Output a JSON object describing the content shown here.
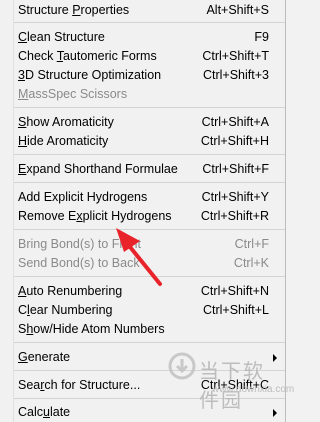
{
  "menu": {
    "items": [
      {
        "label": "Structure Properties",
        "u": 10,
        "shortcut": "Alt+Shift+S",
        "enabled": true
      },
      {
        "label": "Clean Structure",
        "u": 0,
        "shortcut": "F9",
        "enabled": true
      },
      {
        "label": "Check Tautomeric Forms",
        "u": 6,
        "shortcut": "Ctrl+Shift+T",
        "enabled": true
      },
      {
        "label": "3D Structure Optimization",
        "u": 0,
        "shortcut": "Ctrl+Shift+3",
        "enabled": true
      },
      {
        "label": "MassSpec Scissors",
        "u": 0,
        "shortcut": "",
        "enabled": false
      },
      {
        "label": "Show Aromaticity",
        "u": 0,
        "shortcut": "Ctrl+Shift+A",
        "enabled": true
      },
      {
        "label": "Hide Aromaticity",
        "u": 0,
        "shortcut": "Ctrl+Shift+H",
        "enabled": true
      },
      {
        "label": "Expand Shorthand Formulae",
        "u": 0,
        "shortcut": "Ctrl+Shift+F",
        "enabled": true
      },
      {
        "label": "Add Explicit Hydrogens",
        "u": -1,
        "shortcut": "Ctrl+Shift+Y",
        "enabled": true
      },
      {
        "label": "Remove Explicit Hydrogens",
        "u": 8,
        "shortcut": "Ctrl+Shift+R",
        "enabled": true
      },
      {
        "label": "Bring Bond(s) to Front",
        "u": -1,
        "shortcut": "Ctrl+F",
        "enabled": false
      },
      {
        "label": "Send Bond(s) to Back",
        "u": -1,
        "shortcut": "Ctrl+K",
        "enabled": false
      },
      {
        "label": "Auto Renumbering",
        "u": 0,
        "shortcut": "Ctrl+Shift+N",
        "enabled": true
      },
      {
        "label": "Clear Numbering",
        "u": 1,
        "shortcut": "Ctrl+Shift+L",
        "enabled": true
      },
      {
        "label": "Show/Hide Atom Numbers",
        "u": 1,
        "shortcut": "",
        "enabled": true
      },
      {
        "label": "Generate",
        "u": 0,
        "shortcut": "",
        "enabled": true,
        "submenu": true
      },
      {
        "label": "Search for Structure...",
        "u": 3,
        "shortcut": "Ctrl+Shift+C",
        "enabled": true
      },
      {
        "label": "Calculate",
        "u": 4,
        "shortcut": "",
        "enabled": true,
        "submenu": true
      }
    ]
  },
  "watermark": {
    "text": "当下软件园",
    "url": "www.downxia.com"
  },
  "colors": {
    "annotation_arrow": "#e8232a",
    "menu_bg": "#f1f1f1",
    "disabled_text": "#8a8a8a"
  }
}
